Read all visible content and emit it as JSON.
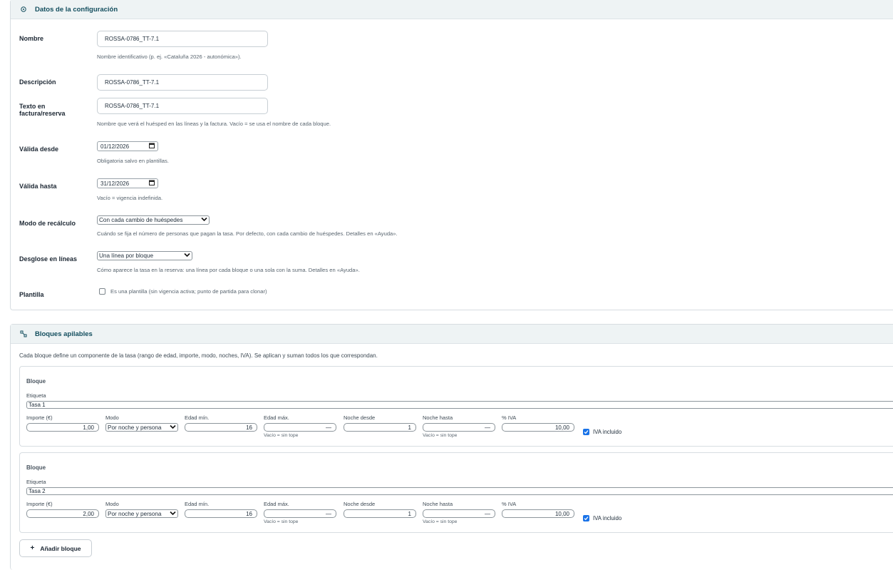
{
  "config": {
    "title": "Datos de la configuración",
    "icon": "gear-icon",
    "nombre": {
      "label": "Nombre",
      "value": "ROSSA-0786_TT-7.1",
      "help": "Nombre identificativo (p. ej. «Cataluña 2026 - autonómica»)."
    },
    "descripcion": {
      "label": "Descripción",
      "value": "ROSSA-0786_TT-7.1"
    },
    "texto_factura": {
      "label_line1": "Texto en",
      "label_line2": "factura/reserva",
      "value": "ROSSA-0786_TT-7.1",
      "help": "Nombre que verá el huésped en las líneas y la factura. Vacío = se usa el nombre de cada bloque."
    },
    "valida_desde": {
      "label": "Válida desde",
      "value": "01/12/2026",
      "help": "Obligatoria salvo en plantillas."
    },
    "valida_hasta": {
      "label": "Válida hasta",
      "value": "31/12/2026",
      "help": "Vacío = vigencia indefinida."
    },
    "modo_recalculo": {
      "label": "Modo de recálculo",
      "value": "Con cada cambio de huéspedes",
      "help": "Cuándo se fija el número de personas que pagan la tasa. Por defecto, con cada cambio de huéspedes. Detalles en «Ayuda»."
    },
    "desglose": {
      "label": "Desglose en líneas",
      "value": "Una línea por bloque",
      "help": "Cómo aparece la tasa en la reserva: una línea por cada bloque o una sola con la suma. Detalles en «Ayuda»."
    },
    "plantilla": {
      "label": "Plantilla",
      "checkbox_label": "Es una plantilla (sin vigencia activa; punto de partida para clonar)",
      "checked": false
    }
  },
  "bloques": {
    "title": "Bloques apilables",
    "icon": "blocks-icon",
    "description": "Cada bloque define un componente de la tasa (rango de edad, importe, modo, noches, IVA). Se aplican y suman todos los que correspondan.",
    "columns": {
      "etiqueta": "Etiqueta",
      "importe": "Importe (€)",
      "modo": "Modo",
      "edad_min": "Edad mín.",
      "edad_max": "Edad máx.",
      "noche_desde": "Noche desde",
      "noche_hasta": "Noche hasta",
      "iva": "% IVA",
      "iva_incluido": "IVA incluido",
      "sin_tope": "Vacío = sin tope"
    },
    "items": [
      {
        "title": "Bloque",
        "etiqueta": "Tasa 1",
        "importe": "1,00",
        "modo": "Por noche y persona",
        "edad_min": "16",
        "edad_max": "—",
        "noche_desde": "1",
        "noche_hasta": "—",
        "iva": "10,00",
        "iva_incluido": true
      },
      {
        "title": "Bloque",
        "etiqueta": "Tasa 2",
        "importe": "2,00",
        "modo": "Por noche y persona",
        "edad_min": "16",
        "edad_max": "—",
        "noche_desde": "1",
        "noche_hasta": "—",
        "iva": "10,00",
        "iva_incluido": true
      }
    ],
    "add_button": {
      "icon": "plus-icon",
      "label": "Añadir bloque"
    }
  }
}
